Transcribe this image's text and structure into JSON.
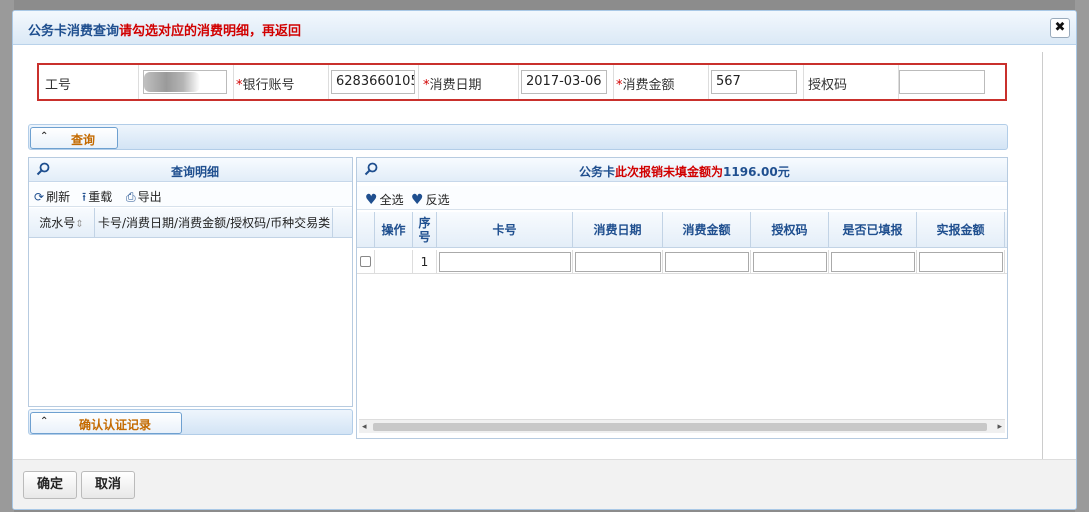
{
  "dialog": {
    "title_part1": "公务卡消费查询",
    "title_part2": "请勾选对应的消费明细，再返回",
    "close_glyph": "✖"
  },
  "form": {
    "employee_id": {
      "label": "工号",
      "value": ""
    },
    "bank_account": {
      "required": "*",
      "label": "银行账号",
      "value": "6283660105:"
    },
    "consume_date": {
      "required": "*",
      "label": "消费日期",
      "value": "2017-03-06"
    },
    "consume_amount": {
      "required": "*",
      "label": "消费金额",
      "value": "567"
    },
    "auth_code": {
      "label": "授权码",
      "value": ""
    }
  },
  "query_section": {
    "caret": "⌃",
    "button_label": "查询"
  },
  "left_panel": {
    "title": "查询明细",
    "toolbar": {
      "refresh": "刷新",
      "reload": "重载",
      "export": "导出"
    },
    "columns": [
      "流水号",
      "卡号/消费日期/消费金额/授权码/币种交易类"
    ],
    "sort_glyph": "⇕"
  },
  "confirm_section": {
    "caret": "⌃",
    "button_label": "确认认证记录"
  },
  "right_panel": {
    "title_part1": "公务卡",
    "title_part2": "此次报销未填金额为",
    "title_amount": "1196.00元",
    "toolbar": {
      "select_all": "全选",
      "invert": "反选"
    },
    "columns": [
      "操作",
      "序号",
      "卡号",
      "消费日期",
      "消费金额",
      "授权码",
      "是否已填报",
      "实报金额"
    ],
    "rows": [
      {
        "index": "1"
      }
    ],
    "scroll_left": "◂",
    "scroll_right": "▸"
  },
  "footer": {
    "ok": "确定",
    "cancel": "取消"
  },
  "colors": {
    "accent_blue": "#1f4f8f",
    "highlight_red": "#d10000",
    "button_orange": "#c46a00"
  },
  "icons": [
    "close-icon",
    "search-icon",
    "refresh-icon",
    "upload-icon",
    "printer-icon",
    "heart-icon",
    "caret-up-icon",
    "sort-icon"
  ]
}
